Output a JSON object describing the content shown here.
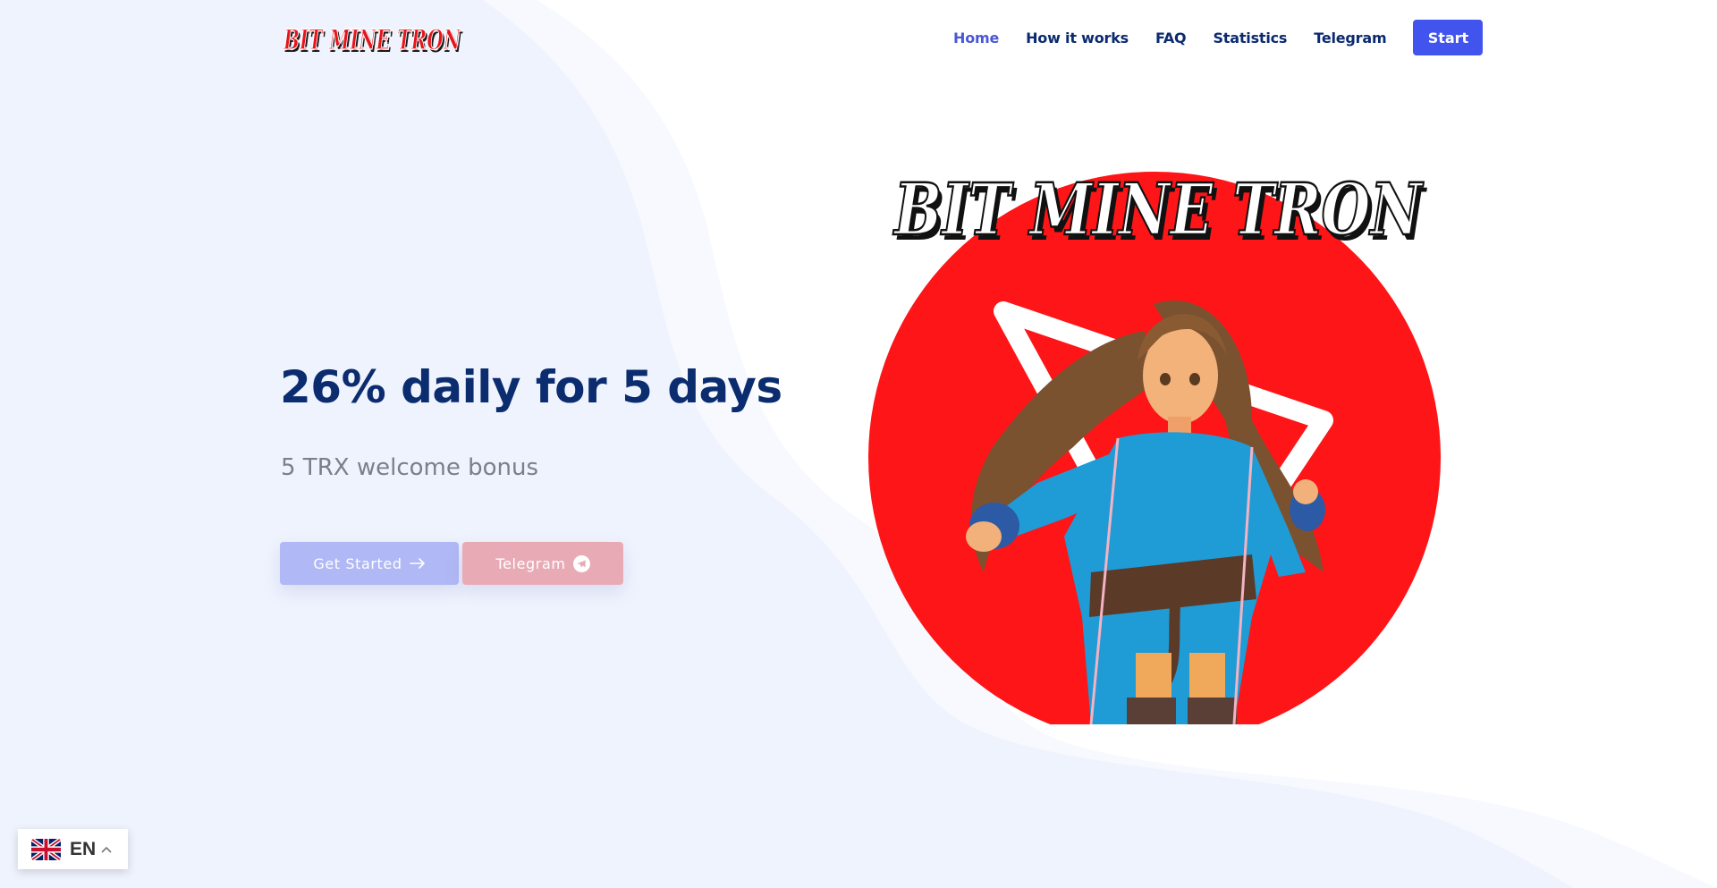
{
  "brand": {
    "logo_text": "BIT MINE TRON",
    "logo_color": "#e8131b"
  },
  "nav": {
    "items": [
      {
        "label": "Home",
        "active": true
      },
      {
        "label": "How it works",
        "active": false
      },
      {
        "label": "FAQ",
        "active": false
      },
      {
        "label": "Statistics",
        "active": false
      },
      {
        "label": "Telegram",
        "active": false
      }
    ],
    "cta_label": "Start"
  },
  "hero": {
    "title": "26% daily for 5 days",
    "subtitle": "5 TRX welcome bonus",
    "buttons": {
      "get_started": "Get Started",
      "get_started_icon": "arrow-right-icon",
      "telegram": "Telegram",
      "telegram_icon": "telegram-icon"
    },
    "art": {
      "headline": "BIT MINE TRON",
      "description": "Anime martial artist in blue outfit over red circle with white Telegram arrow",
      "circle_color": "#fd1518"
    }
  },
  "language": {
    "code": "EN",
    "flag": "uk-flag-icon",
    "caret": "chevron-up-icon"
  },
  "colors": {
    "navy": "#0b2c6e",
    "accent": "#4254ee",
    "active_nav": "#4a58d4",
    "bg_wave_inner": "#eff3fd",
    "bg_wave_outer": "#f7f9fe"
  }
}
